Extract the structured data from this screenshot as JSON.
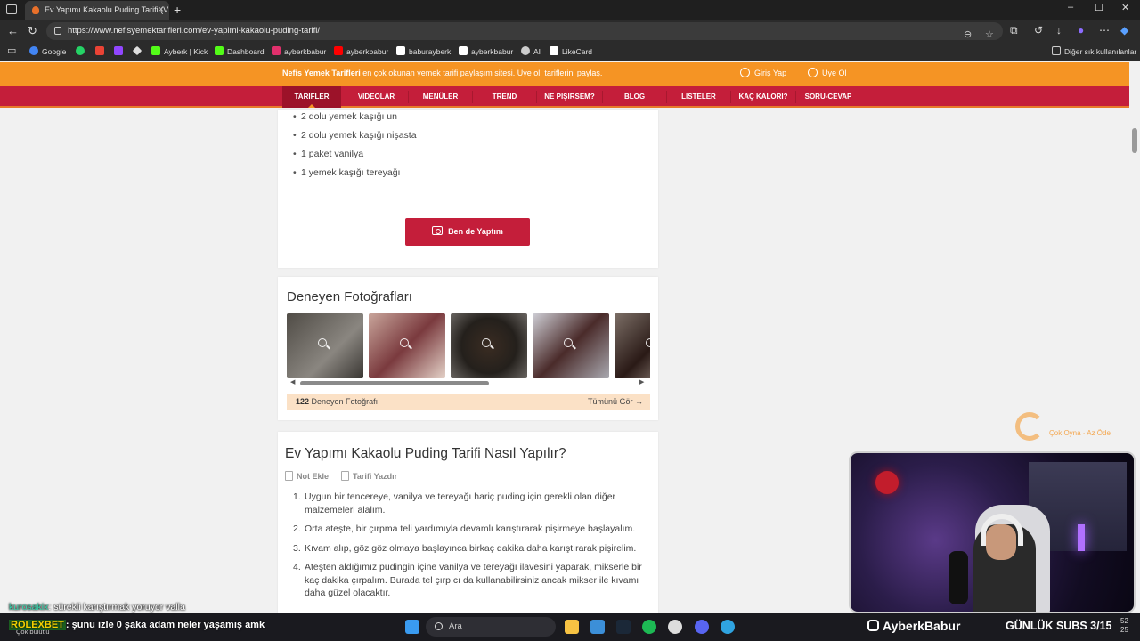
{
  "browser": {
    "tab_title": "Ev Yapımı Kakaolu Puding Tarifi (V",
    "new_tab": "+",
    "url": "https://www.nefisyemektarifleri.com/ev-yapimi-kakaolu-puding-tarifi/",
    "window_controls": [
      "–",
      "☐",
      "✕"
    ]
  },
  "bookmarks": [
    {
      "label": "Google",
      "icon": "google-icon",
      "color": "#4285f4"
    },
    {
      "label": "",
      "icon": "whatsapp-icon",
      "color": "#25d366"
    },
    {
      "label": "",
      "icon": "gmail-icon",
      "color": "#ea4335"
    },
    {
      "label": "",
      "icon": "twitch-icon",
      "color": "#9146ff"
    },
    {
      "label": "",
      "icon": "gem-icon",
      "color": "#dddddd"
    },
    {
      "label": "Ayberk | Kick",
      "icon": "kick-icon",
      "color": "#53fc18"
    },
    {
      "label": "Dashboard",
      "icon": "kick-icon",
      "color": "#53fc18"
    },
    {
      "label": "ayberkbabur",
      "icon": "instagram-icon",
      "color": "#e1306c"
    },
    {
      "label": "ayberkbabur",
      "icon": "youtube-icon",
      "color": "#ff0000"
    },
    {
      "label": "baburayberk",
      "icon": "x-icon",
      "color": "#ffffff"
    },
    {
      "label": "ayberkbabur",
      "icon": "tiktok-icon",
      "color": "#ffffff"
    },
    {
      "label": "AI",
      "icon": "openai-icon",
      "color": "#cccccc"
    },
    {
      "label": "LikeCard",
      "icon": "likecard-icon",
      "color": "#ffffff"
    }
  ],
  "other_bookmarks": "Diğer sık kullanılanlar",
  "site": {
    "promo_brand": "Nefis Yemek Tarifleri",
    "promo_text": " en çok okunan yemek tarifi paylaşım sitesi. ",
    "promo_link": "Üye ol,",
    "promo_tail": " tariflerini paylaş.",
    "login": "Giriş Yap",
    "signup": "Üye Ol",
    "nav": [
      "TARİFLER",
      "VİDEOLAR",
      "MENÜLER",
      "TREND",
      "NE PİŞİRSEM?",
      "BLOG",
      "LİSTELER",
      "KAÇ KALORİ?",
      "SORU-CEVAP"
    ]
  },
  "ingredients": [
    "2 dolu yemek kaşığı un",
    "2 dolu yemek kaşığı nişasta",
    "1 paket vanilya",
    "1 yemek kaşığı tereyağı"
  ],
  "made_button": "Ben de Yaptım",
  "photos_section": {
    "title": "Deneyen Fotoğrafları",
    "count": "122",
    "count_label": " Deneyen Fotoğrafı",
    "see_all": "Tümünü Gör →",
    "photo_colors": [
      "#6e6a62",
      "#a67a6c",
      "#2c2520",
      "#8f8d90",
      "#3e2f2a"
    ]
  },
  "howto": {
    "title": "Ev Yapımı Kakaolu Puding Tarifi Nasıl Yapılır?",
    "add_note": "Not Ekle",
    "print": "Tarifi Yazdır",
    "steps": [
      {
        "num": "1.",
        "text": "Uygun bir tencereye, vanilya ve tereyağı hariç puding için gerekli olan diğer malzemeleri alalım."
      },
      {
        "num": "2.",
        "text": "Orta ateşte, bir çırpma teli yardımıyla devamlı karıştırarak pişirmeye başlayalım."
      },
      {
        "num": "3.",
        "text": "Kıvam alıp, göz göz olmaya başlayınca birkaç dakika daha karıştırarak pişirelim."
      },
      {
        "num": "4.",
        "text": "Ateşten aldığımız pudingin içine vanilya ve tereyağı ilavesini yaparak, mikserle bir kaç dakika çırpalım. Burada tel çırpıcı da kullanabilirsiniz ancak mikser ile kıvamı daha güzel olacaktır."
      }
    ]
  },
  "watermark": "Çok Oyna · Az Öde",
  "overlay": {
    "chat1_user": "kurosakix",
    "chat1_text": ": sürekli karıştırmak yoruyor valla",
    "chat2_brand": "ROLEXBET",
    "chat2_text": ": şunu izle 0 şaka adam neler yaşamış amk",
    "weather": "Çok bulutlu",
    "instagram": "AyberkBabur",
    "subs": "GÜNLÜK SUBS 3/15"
  },
  "taskbar": {
    "search": "Ara",
    "clock_top": "52",
    "clock_bottom": "25"
  }
}
